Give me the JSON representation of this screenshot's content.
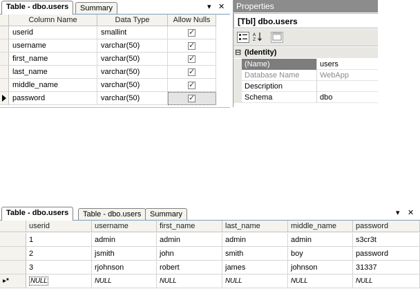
{
  "designer": {
    "tabs": [
      "Table - dbo.users",
      "Summary"
    ],
    "pin_label": "▾",
    "close_label": "✕",
    "headers": [
      "Column Name",
      "Data Type",
      "Allow Nulls"
    ],
    "rows": [
      {
        "name": "userid",
        "type": "smallint",
        "allow_nulls": true
      },
      {
        "name": "username",
        "type": "varchar(50)",
        "allow_nulls": true
      },
      {
        "name": "first_name",
        "type": "varchar(50)",
        "allow_nulls": true
      },
      {
        "name": "last_name",
        "type": "varchar(50)",
        "allow_nulls": true
      },
      {
        "name": "middle_name",
        "type": "varchar(50)",
        "allow_nulls": true
      },
      {
        "name": "password",
        "type": "varchar(50)",
        "allow_nulls": true
      }
    ]
  },
  "properties": {
    "title": "Properties",
    "object": "[Tbl] dbo.users",
    "category": "(Identity)",
    "collapse_glyph": "⊟",
    "rows": [
      {
        "name": "(Name)",
        "value": "users"
      },
      {
        "name": "Database Name",
        "value": "WebApp"
      },
      {
        "name": "Description",
        "value": ""
      },
      {
        "name": "Schema",
        "value": "dbo"
      }
    ]
  },
  "results": {
    "tabs": [
      "Table - dbo.users",
      "Table - dbo.users",
      "Summary"
    ],
    "pin_label": "▾",
    "close_label": "✕",
    "headers": [
      "userid",
      "username",
      "first_name",
      "last_name",
      "middle_name",
      "password"
    ],
    "rows": [
      [
        "1",
        "admin",
        "admin",
        "admin",
        "admin",
        "s3cr3t"
      ],
      [
        "2",
        "jsmith",
        "john",
        "smith",
        "boy",
        "password"
      ],
      [
        "3",
        "rjohnson",
        "robert",
        "james",
        "johnson",
        "31337"
      ]
    ],
    "new_row": [
      "NULL",
      "NULL",
      "NULL",
      "NULL",
      "NULL",
      "NULL"
    ],
    "new_row_marker": "▸*"
  }
}
